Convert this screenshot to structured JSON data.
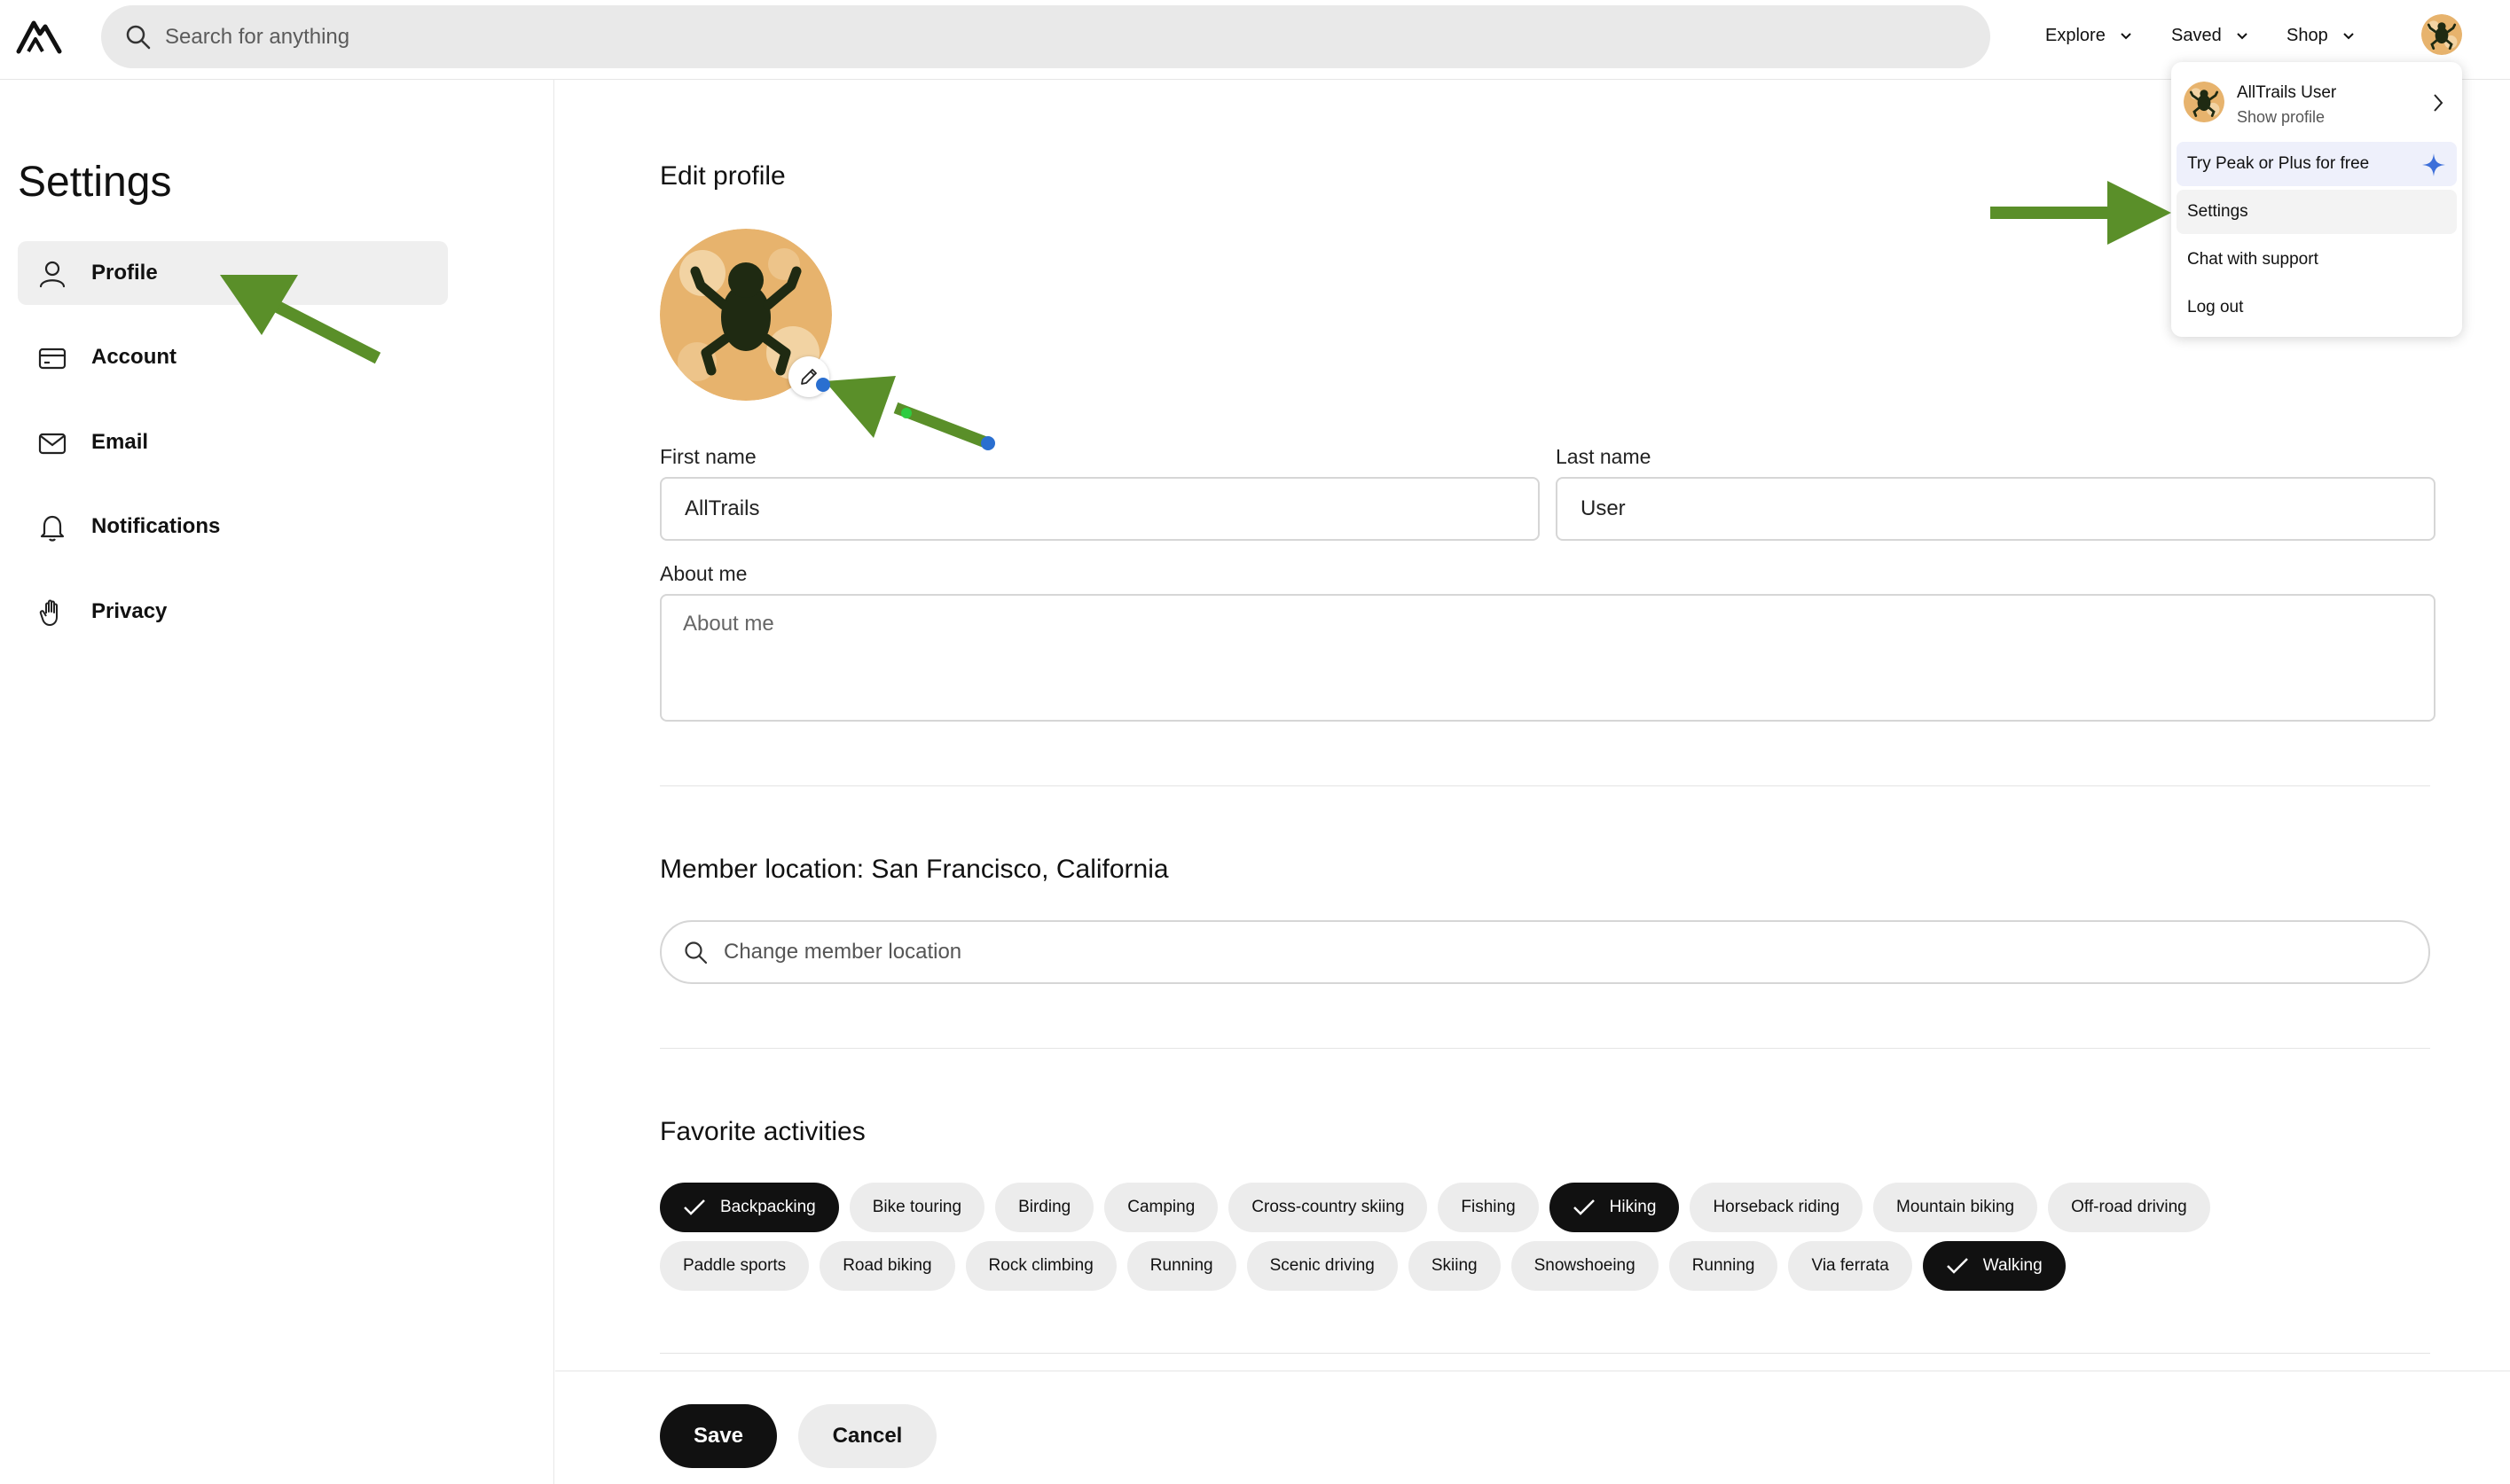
{
  "header": {
    "search_placeholder": "Search for anything",
    "nav": [
      {
        "label": "Explore"
      },
      {
        "label": "Saved"
      },
      {
        "label": "Shop"
      }
    ]
  },
  "sidebar": {
    "title": "Settings",
    "items": [
      {
        "label": "Profile",
        "icon": "person-icon",
        "active": true
      },
      {
        "label": "Account",
        "icon": "card-icon"
      },
      {
        "label": "Email",
        "icon": "mail-icon"
      },
      {
        "label": "Notifications",
        "icon": "bell-icon"
      },
      {
        "label": "Privacy",
        "icon": "hand-icon"
      }
    ]
  },
  "profile": {
    "heading": "Edit profile",
    "first_name_label": "First name",
    "first_name_value": "AllTrails",
    "last_name_label": "Last name",
    "last_name_value": "User",
    "about_label": "About me",
    "about_placeholder": "About me"
  },
  "location": {
    "heading": "Member location: San Francisco, California",
    "placeholder": "Change member location"
  },
  "activities": {
    "heading": "Favorite activities",
    "row1": [
      {
        "label": "Backpacking",
        "selected": true
      },
      {
        "label": "Bike touring"
      },
      {
        "label": "Birding"
      },
      {
        "label": "Camping"
      },
      {
        "label": "Cross-country skiing"
      },
      {
        "label": "Fishing"
      },
      {
        "label": "Hiking",
        "selected": true
      },
      {
        "label": "Horseback riding"
      },
      {
        "label": "Mountain biking"
      },
      {
        "label": "Off-road driving"
      }
    ],
    "row2": [
      {
        "label": "Paddle sports"
      },
      {
        "label": "Road biking"
      },
      {
        "label": "Rock climbing"
      },
      {
        "label": "Running"
      },
      {
        "label": "Scenic driving"
      },
      {
        "label": "Skiing"
      },
      {
        "label": "Snowshoeing"
      },
      {
        "label": "Running"
      },
      {
        "label": "Via ferrata"
      },
      {
        "label": "Walking",
        "selected": true
      }
    ]
  },
  "actions": {
    "save": "Save",
    "cancel": "Cancel"
  },
  "menu": {
    "user_name": "AllTrails User",
    "show_profile": "Show profile",
    "peak": "Try Peak or Plus for free",
    "settings": "Settings",
    "support": "Chat with support",
    "logout": "Log out"
  },
  "colors": {
    "annotation_arrow": "#5a8f29",
    "selected_chip": "#111111",
    "sparkle": "#3d6fd9",
    "avatar_bg": "#e7b36d",
    "frog": "#1f2a12"
  }
}
